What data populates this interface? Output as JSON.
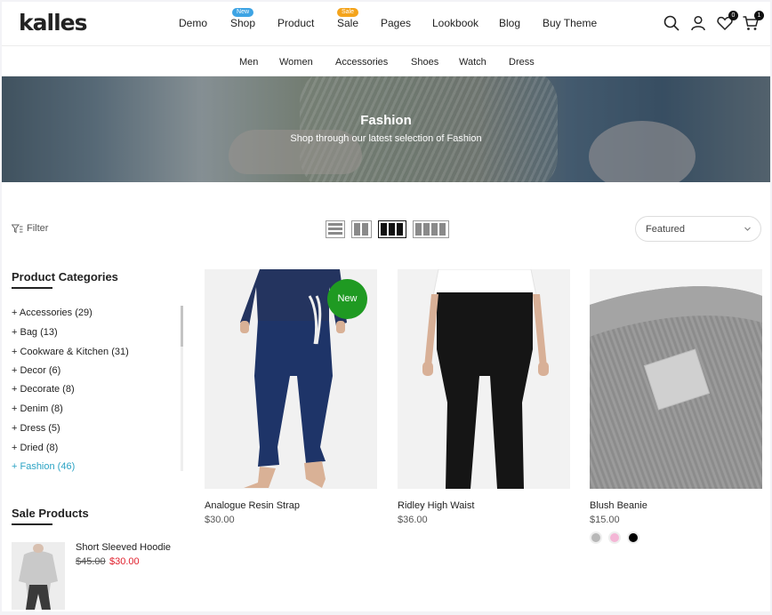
{
  "brand": {
    "logo_text": "kalles"
  },
  "nav": {
    "items": [
      {
        "label": "Demo"
      },
      {
        "label": "Shop",
        "badge": "New"
      },
      {
        "label": "Product"
      },
      {
        "label": "Sale",
        "badge": "Sale"
      },
      {
        "label": "Pages"
      },
      {
        "label": "Lookbook"
      },
      {
        "label": "Blog"
      },
      {
        "label": "Buy Theme"
      }
    ],
    "wishlist_count": "0",
    "cart_count": "1"
  },
  "subnav": {
    "items": [
      "Men",
      "Women",
      "Accessories",
      "Shoes",
      "Watch",
      "Dress"
    ]
  },
  "hero": {
    "title": "Fashion",
    "subtitle": "Shop through our latest selection of Fashion"
  },
  "toolbar": {
    "filter_label": "Filter",
    "sort_selected": "Featured"
  },
  "sidebar": {
    "categories_title": "Product Categories",
    "categories": [
      "+ Accessories (29)",
      "+ Bag (13)",
      "+ Cookware & Kitchen (31)",
      "+ Decor (6)",
      "+ Decorate (8)",
      "+ Denim (8)",
      "+ Dress (5)",
      "+ Dried (8)",
      "+ Fashion (46)"
    ],
    "sale_title": "Sale Products",
    "sale_item": {
      "name": "Short Sleeved Hoodie",
      "old_price": "$45.00",
      "new_price": "$30.00"
    }
  },
  "products": [
    {
      "name": "Analogue Resin Strap",
      "price": "$30.00",
      "badge": "New"
    },
    {
      "name": "Ridley High Waist",
      "price": "$36.00"
    },
    {
      "name": "Blush Beanie",
      "price": "$15.00",
      "swatch_colors": [
        "#b8b8b8",
        "#f4b6d6",
        "#000000"
      ]
    }
  ],
  "colors": {
    "accent": "#2ba3c4",
    "sale_red": "#e01e2b",
    "new_badge": "#1f9a22"
  }
}
